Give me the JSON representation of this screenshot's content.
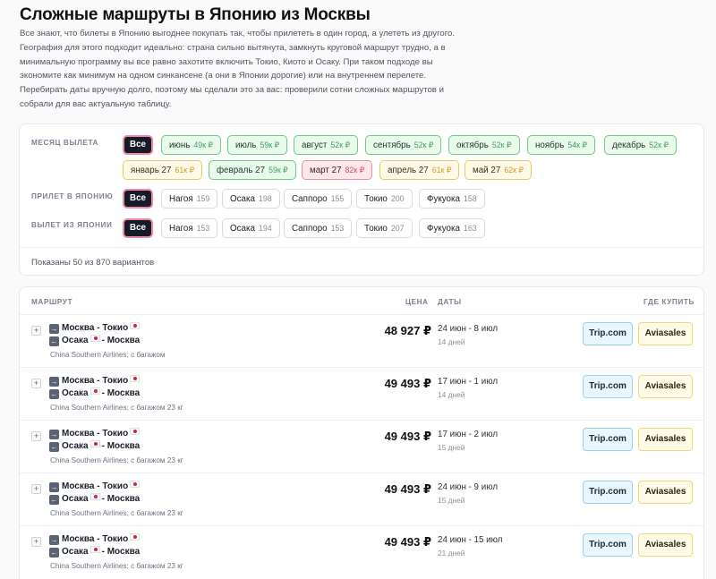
{
  "page": {
    "title": "Сложные маршруты в Японию из Москвы",
    "intro": [
      "Все знают, что билеты в Японию выгоднее покупать так, чтобы прилететь в один город, а улететь из другого.",
      "География для этого подходит идеально: страна сильно вытянута, замкнуть круговой маршрут трудно, а в",
      "минимальную программу вы все равно захотите включить Токио, Киото и Осаку. При таком подходе вы",
      "экономите как минимум на одном синкансене (а они в Японии дорогие) или на внутреннем перелете.",
      "Перебирать даты вручную долго, поэтому мы сделали это за вас: проверили сотни сложных маршрутов и",
      "собрали для вас актуальную таблицу."
    ]
  },
  "filters": {
    "month_label": "МЕСЯЦ ВЫЛЕТА",
    "arrival_label": "ПРИЛЕТ В ЯПОНИЮ",
    "departure_label": "ВЫЛЕТ ИЗ ЯПОНИИ",
    "all_label": "Все",
    "months": [
      {
        "label": "июнь",
        "price": "49к ₽",
        "color": "green"
      },
      {
        "label": "июль",
        "price": "59к ₽",
        "color": "green"
      },
      {
        "label": "август",
        "price": "52к ₽",
        "color": "green"
      },
      {
        "label": "сентябрь",
        "price": "52к ₽",
        "color": "green"
      },
      {
        "label": "октябрь",
        "price": "52к ₽",
        "color": "green"
      },
      {
        "label": "ноябрь",
        "price": "54к ₽",
        "color": "green"
      },
      {
        "label": "декабрь",
        "price": "52к ₽",
        "color": "green"
      },
      {
        "label": "январь 27",
        "price": "61к ₽",
        "color": "yellow"
      },
      {
        "label": "февраль 27",
        "price": "59к ₽",
        "color": "green"
      },
      {
        "label": "март 27",
        "price": "82к ₽",
        "color": "red"
      },
      {
        "label": "апрель 27",
        "price": "61к ₽",
        "color": "yellow"
      },
      {
        "label": "май 27",
        "price": "62к ₽",
        "color": "yellow"
      }
    ],
    "arrival": [
      {
        "label": "Нагоя",
        "count": "159"
      },
      {
        "label": "Осака",
        "count": "198"
      },
      {
        "label": "Саппоро",
        "count": "155"
      },
      {
        "label": "Токио",
        "count": "200"
      },
      {
        "label": "Фукуока",
        "count": "158"
      }
    ],
    "departure": [
      {
        "label": "Нагоя",
        "count": "153"
      },
      {
        "label": "Осака",
        "count": "194"
      },
      {
        "label": "Саппоро",
        "count": "153"
      },
      {
        "label": "Токио",
        "count": "207"
      },
      {
        "label": "Фукуока",
        "count": "163"
      }
    ],
    "shown_text": "Показаны 50 из 870 вариантов"
  },
  "table": {
    "headers": {
      "route": "МАРШРУТ",
      "price": "ЦЕНА",
      "dates": "ДАТЫ",
      "buy": "ГДЕ КУПИТЬ"
    },
    "expand_symbol": "+",
    "rows": [
      {
        "out_from": "Москва - Токио",
        "back_from": "Осака",
        "back_to": "- Москва",
        "airline": "China Southern Airlines; с багажом",
        "price": "48 927 ₽",
        "dates": "24 июн - 8 июл",
        "days": "14 дней",
        "trip": "Trip.com",
        "avia": "Aviasales"
      },
      {
        "out_from": "Москва - Токио",
        "back_from": "Осака",
        "back_to": "- Москва",
        "airline": "China Southern Airlines; с багажом 23 кг",
        "price": "49 493 ₽",
        "dates": "17 июн - 1 июл",
        "days": "14 дней",
        "trip": "Trip.com",
        "avia": "Aviasales"
      },
      {
        "out_from": "Москва - Токио",
        "back_from": "Осака",
        "back_to": "- Москва",
        "airline": "China Southern Airlines; с багажом 23 кг",
        "price": "49 493 ₽",
        "dates": "17 июн - 2 июл",
        "days": "15 дней",
        "trip": "Trip.com",
        "avia": "Aviasales"
      },
      {
        "out_from": "Москва - Токио",
        "back_from": "Осака",
        "back_to": "- Москва",
        "airline": "China Southern Airlines; с багажом 23 кг",
        "price": "49 493 ₽",
        "dates": "24 июн - 9 июл",
        "days": "15 дней",
        "trip": "Trip.com",
        "avia": "Aviasales"
      },
      {
        "out_from": "Москва - Токио",
        "back_from": "Осака",
        "back_to": "- Москва",
        "airline": "China Southern Airlines; с багажом 23 кг",
        "price": "49 493 ₽",
        "dates": "24 июн - 15 июл",
        "days": "21 дней",
        "trip": "Trip.com",
        "avia": "Aviasales"
      }
    ]
  }
}
